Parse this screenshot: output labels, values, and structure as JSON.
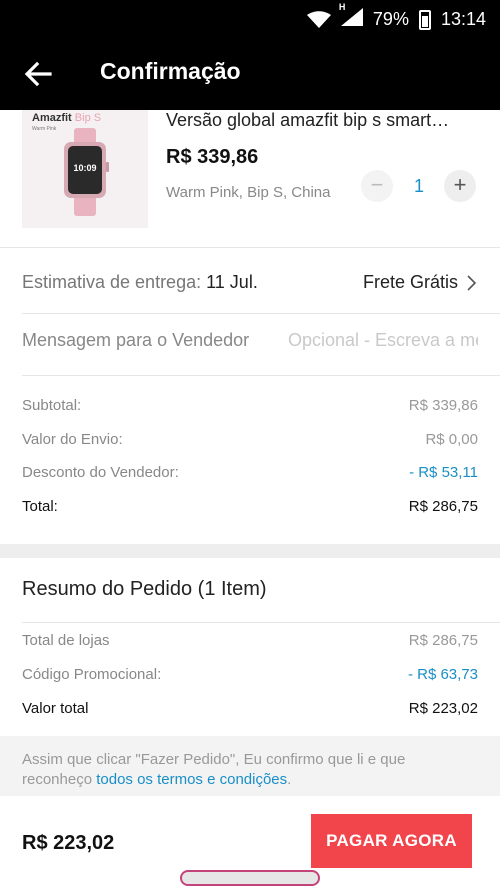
{
  "status_bar": {
    "network_type": "H",
    "battery": "79%",
    "time": "13:14"
  },
  "header": {
    "title": "Confirmação"
  },
  "product": {
    "brand": "Amazfit",
    "brand_model": "Bip S",
    "brand_sub": "Warm Pink",
    "watch_time": "10:09",
    "name": "Versão global amazfit bip s smart…",
    "price": "R$ 339,86",
    "variant": "Warm Pink, Bip S, China",
    "quantity": "1",
    "minus_symbol": "−",
    "plus_symbol": "+"
  },
  "delivery": {
    "label": "Estimativa de entrega:",
    "date": "11 Jul.",
    "shipping": "Frete Grátis"
  },
  "message": {
    "label": "Mensagem para o Vendedor",
    "placeholder": "Opcional - Escreva a mensagem"
  },
  "order": {
    "subtotal_label": "Subtotal:",
    "subtotal": "R$ 339,86",
    "shipping_label": "Valor do Envio:",
    "shipping": "R$ 0,00",
    "discount_label": "Desconto do Vendedor:",
    "discount": "- R$ 53,11",
    "total_label": "Total:",
    "total": "R$ 286,75"
  },
  "summary": {
    "title": "Resumo do Pedido (1 Item)",
    "stores_label": "Total de lojas",
    "stores": "R$ 286,75",
    "promo_label": "Código Promocional:",
    "promo": "- R$ 63,73",
    "grand_label": "Valor total",
    "grand": "R$ 223,02"
  },
  "terms": {
    "text": "Assim que clicar \"Fazer Pedido\", Eu confirmo que li e que reconheço ",
    "link": "todos os termos e condições",
    "end": "."
  },
  "footer": {
    "total": "R$ 223,02",
    "pay_button": "PAGAR AGORA"
  },
  "colors": {
    "accent_red": "#f1444b",
    "link_blue": "#1a8fc6",
    "watch_pink": "#e9b3c0"
  }
}
